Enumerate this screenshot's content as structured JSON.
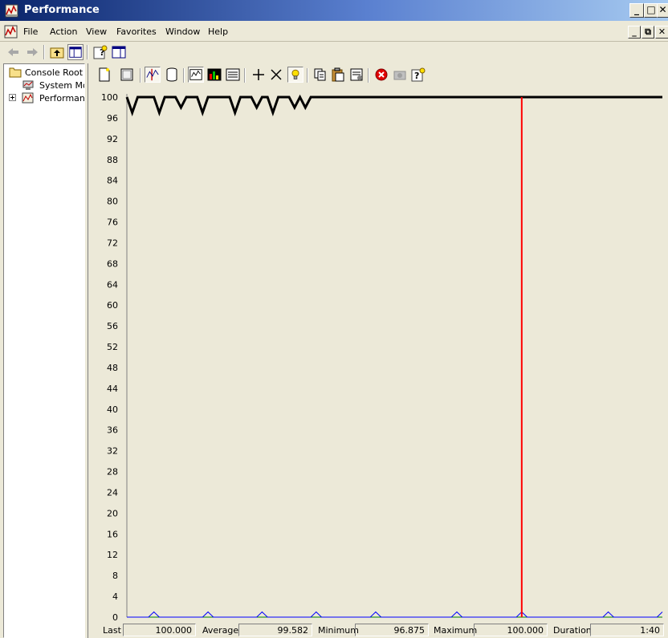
{
  "window": {
    "title": "Performance"
  },
  "menu": {
    "items": [
      "File",
      "Action",
      "View",
      "Favorites",
      "Window",
      "Help"
    ]
  },
  "tree": {
    "items": [
      {
        "label": "Console Root"
      },
      {
        "label": "System Monitor"
      },
      {
        "label": "Performance Logs and Alerts"
      }
    ]
  },
  "chart_data": {
    "type": "line",
    "ylim": [
      0,
      100
    ],
    "y_ticks": [
      "100",
      "96",
      "92",
      "88",
      "84",
      "80",
      "76",
      "72",
      "68",
      "64",
      "60",
      "56",
      "52",
      "48",
      "44",
      "40",
      "36",
      "32",
      "28",
      "24",
      "20",
      "16",
      "12",
      "8",
      "4",
      "0"
    ],
    "samples": 100,
    "current_position": 73,
    "series": [
      {
        "color": "#000000",
        "values": [
          100,
          97,
          100,
          100,
          100,
          100,
          97,
          100,
          100,
          100,
          98,
          100,
          100,
          100,
          97,
          100,
          100,
          100,
          100,
          100,
          97,
          100,
          100,
          100,
          98,
          100,
          100,
          97,
          100,
          100,
          100,
          98,
          100,
          98,
          100,
          100,
          100,
          100,
          100,
          100,
          100,
          100,
          100,
          100,
          100,
          100,
          100,
          100,
          100,
          100,
          100,
          100,
          100,
          100,
          100,
          100,
          100,
          100,
          100,
          100,
          100,
          100,
          100,
          100,
          100,
          100,
          100,
          100,
          100,
          100,
          100,
          100,
          100,
          100,
          100,
          100,
          100,
          100,
          100,
          100,
          100,
          100,
          100,
          100,
          100,
          100,
          100,
          100,
          100,
          100,
          100,
          100,
          100,
          100,
          100,
          100,
          100,
          100,
          100,
          100
        ]
      },
      {
        "color": "#0000ff",
        "values": [
          0,
          0,
          0,
          0,
          0,
          1,
          0,
          0,
          0,
          0,
          0,
          0,
          0,
          0,
          0,
          1,
          0,
          0,
          0,
          0,
          0,
          0,
          0,
          0,
          0,
          1,
          0,
          0,
          0,
          0,
          0,
          0,
          0,
          0,
          0,
          1,
          0,
          0,
          0,
          0,
          0,
          0,
          0,
          0,
          0,
          0,
          1,
          0,
          0,
          0,
          0,
          0,
          0,
          0,
          0,
          0,
          0,
          0,
          0,
          0,
          0,
          1,
          0,
          0,
          0,
          0,
          0,
          0,
          0,
          0,
          0,
          0,
          0,
          1,
          0,
          0,
          0,
          0,
          0,
          0,
          0,
          0,
          0,
          0,
          0,
          0,
          0,
          0,
          0,
          1,
          0,
          0,
          0,
          0,
          0,
          0,
          0,
          0,
          0,
          1
        ]
      },
      {
        "color": "#008000",
        "values": [
          0,
          0,
          0,
          0,
          0,
          0,
          0,
          0,
          0,
          0,
          0,
          0,
          0,
          0,
          0,
          0,
          0,
          0,
          0,
          0,
          0,
          0,
          0,
          0,
          0,
          0,
          0,
          0,
          0,
          0,
          0,
          0,
          0,
          0,
          0,
          0,
          0,
          0,
          0,
          0,
          0,
          0,
          0,
          0,
          0,
          0,
          0,
          0,
          0,
          0,
          0,
          0,
          0,
          0,
          0,
          0,
          0,
          0,
          0,
          0,
          0,
          0,
          0,
          0,
          0,
          0,
          0,
          0,
          0,
          0,
          0,
          0,
          0,
          0,
          0,
          0,
          0,
          0,
          0,
          0,
          0,
          0,
          0,
          0,
          0,
          0,
          0,
          0,
          0,
          0,
          0,
          0,
          0,
          0,
          0,
          0,
          0,
          0,
          0,
          0
        ]
      }
    ]
  },
  "values": {
    "last_label": "Last",
    "last": "100.000",
    "average_label": "Average",
    "average": "99.582",
    "minimum_label": "Minimum",
    "minimum": "96.875",
    "maximum_label": "Maximum",
    "maximum": "100.000",
    "duration_label": "Duration",
    "duration": "1:40"
  },
  "colors": {
    "timebar": "#ff0000",
    "graph_bg": "#ece9d8"
  }
}
